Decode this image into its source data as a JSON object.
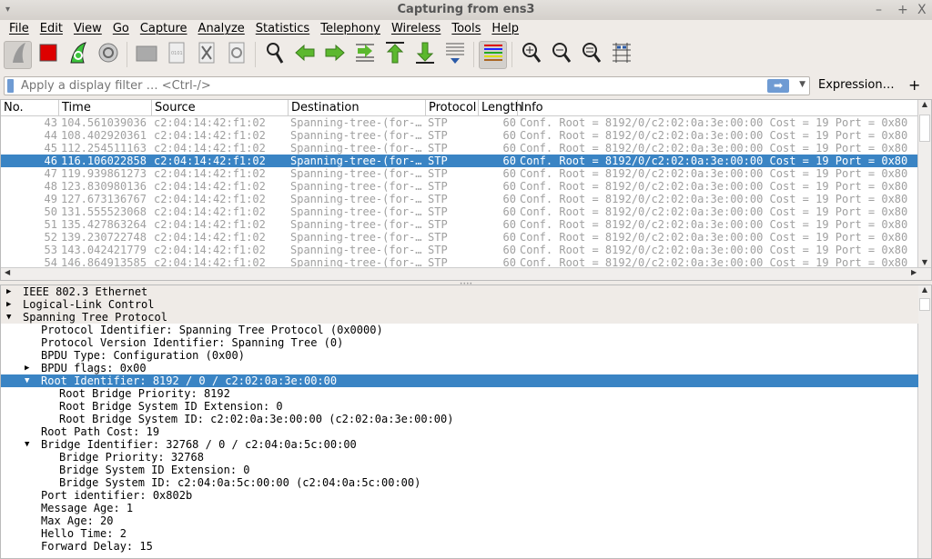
{
  "window": {
    "title": "Capturing from ens3",
    "minimize": "–",
    "maximize": "+",
    "close": "X",
    "menu_arrow": "▾"
  },
  "menu": [
    "File",
    "Edit",
    "View",
    "Go",
    "Capture",
    "Analyze",
    "Statistics",
    "Telephony",
    "Wireless",
    "Tools",
    "Help"
  ],
  "toolbar": [
    "start-capture",
    "stop-capture",
    "restart-capture",
    "capture-options",
    "open-file",
    "save-file",
    "close-file",
    "reload-file",
    "find-packet",
    "go-back",
    "go-forward",
    "go-to-packet",
    "go-first",
    "go-last",
    "auto-scroll",
    "colorize",
    "zoom-in",
    "zoom-out",
    "zoom-normal",
    "resize-columns"
  ],
  "filter": {
    "placeholder": "Apply a display filter … <Ctrl-/>",
    "value": "",
    "expression_label": "Expression…",
    "add_label": "+"
  },
  "packet_list": {
    "columns": [
      "No.",
      "Time",
      "Source",
      "Destination",
      "Protocol",
      "Length",
      "Info"
    ],
    "selected_index": 3,
    "rows": [
      [
        "43",
        "104.561039036",
        "c2:04:14:42:f1:02",
        "Spanning-tree-(for-…",
        "STP",
        "60",
        "Conf. Root = 8192/0/c2:02:0a:3e:00:00  Cost = 19  Port = 0x80"
      ],
      [
        "44",
        "108.402920361",
        "c2:04:14:42:f1:02",
        "Spanning-tree-(for-…",
        "STP",
        "60",
        "Conf. Root = 8192/0/c2:02:0a:3e:00:00  Cost = 19  Port = 0x80"
      ],
      [
        "45",
        "112.254511163",
        "c2:04:14:42:f1:02",
        "Spanning-tree-(for-…",
        "STP",
        "60",
        "Conf. Root = 8192/0/c2:02:0a:3e:00:00  Cost = 19  Port = 0x80"
      ],
      [
        "46",
        "116.106022858",
        "c2:04:14:42:f1:02",
        "Spanning-tree-(for-…",
        "STP",
        "60",
        "Conf. Root = 8192/0/c2:02:0a:3e:00:00  Cost = 19  Port = 0x80"
      ],
      [
        "47",
        "119.939861273",
        "c2:04:14:42:f1:02",
        "Spanning-tree-(for-…",
        "STP",
        "60",
        "Conf. Root = 8192/0/c2:02:0a:3e:00:00  Cost = 19  Port = 0x80"
      ],
      [
        "48",
        "123.830980136",
        "c2:04:14:42:f1:02",
        "Spanning-tree-(for-…",
        "STP",
        "60",
        "Conf. Root = 8192/0/c2:02:0a:3e:00:00  Cost = 19  Port = 0x80"
      ],
      [
        "49",
        "127.673136767",
        "c2:04:14:42:f1:02",
        "Spanning-tree-(for-…",
        "STP",
        "60",
        "Conf. Root = 8192/0/c2:02:0a:3e:00:00  Cost = 19  Port = 0x80"
      ],
      [
        "50",
        "131.555523068",
        "c2:04:14:42:f1:02",
        "Spanning-tree-(for-…",
        "STP",
        "60",
        "Conf. Root = 8192/0/c2:02:0a:3e:00:00  Cost = 19  Port = 0x80"
      ],
      [
        "51",
        "135.427863264",
        "c2:04:14:42:f1:02",
        "Spanning-tree-(for-…",
        "STP",
        "60",
        "Conf. Root = 8192/0/c2:02:0a:3e:00:00  Cost = 19  Port = 0x80"
      ],
      [
        "52",
        "139.230722748",
        "c2:04:14:42:f1:02",
        "Spanning-tree-(for-…",
        "STP",
        "60",
        "Conf. Root = 8192/0/c2:02:0a:3e:00:00  Cost = 19  Port = 0x80"
      ],
      [
        "53",
        "143.042421779",
        "c2:04:14:42:f1:02",
        "Spanning-tree-(for-…",
        "STP",
        "60",
        "Conf. Root = 8192/0/c2:02:0a:3e:00:00  Cost = 19  Port = 0x80"
      ],
      [
        "54",
        "146.864913585",
        "c2:04:14:42:f1:02",
        "Spanning-tree-(for-…",
        "STP",
        "60",
        "Conf. Root = 8192/0/c2:02:0a:3e:00:00  Cost = 19  Port = 0x80"
      ]
    ]
  },
  "details": [
    {
      "level": 0,
      "toggle": "collapsed",
      "text": "IEEE 802.3 Ethernet",
      "header": true
    },
    {
      "level": 0,
      "toggle": "collapsed",
      "text": "Logical-Link Control",
      "header": true
    },
    {
      "level": 0,
      "toggle": "expanded",
      "text": "Spanning Tree Protocol",
      "header": true
    },
    {
      "level": 1,
      "text": "Protocol Identifier: Spanning Tree Protocol (0x0000)"
    },
    {
      "level": 1,
      "text": "Protocol Version Identifier: Spanning Tree (0)"
    },
    {
      "level": 1,
      "text": "BPDU Type: Configuration (0x00)"
    },
    {
      "level": 1,
      "toggle": "collapsed",
      "text": "BPDU flags: 0x00"
    },
    {
      "level": 1,
      "toggle": "expanded",
      "text": "Root Identifier: 8192 / 0 / c2:02:0a:3e:00:00",
      "selected": true
    },
    {
      "level": 2,
      "text": "Root Bridge Priority: 8192"
    },
    {
      "level": 2,
      "text": "Root Bridge System ID Extension: 0"
    },
    {
      "level": 2,
      "text": "Root Bridge System ID: c2:02:0a:3e:00:00 (c2:02:0a:3e:00:00)"
    },
    {
      "level": 1,
      "text": "Root Path Cost: 19"
    },
    {
      "level": 1,
      "toggle": "expanded",
      "text": "Bridge Identifier: 32768 / 0 / c2:04:0a:5c:00:00"
    },
    {
      "level": 2,
      "text": "Bridge Priority: 32768"
    },
    {
      "level": 2,
      "text": "Bridge System ID Extension: 0"
    },
    {
      "level": 2,
      "text": "Bridge System ID: c2:04:0a:5c:00:00 (c2:04:0a:5c:00:00)"
    },
    {
      "level": 1,
      "text": "Port identifier: 0x802b"
    },
    {
      "level": 1,
      "text": "Message Age: 1"
    },
    {
      "level": 1,
      "text": "Max Age: 20"
    },
    {
      "level": 1,
      "text": "Hello Time: 2"
    },
    {
      "level": 1,
      "text": "Forward Delay: 15"
    }
  ],
  "colors": {
    "selection": "#3a84c4",
    "filter_accent": "#6f9bd3",
    "stop_red": "#dd0000",
    "green_arrow": "#5cb82e"
  }
}
